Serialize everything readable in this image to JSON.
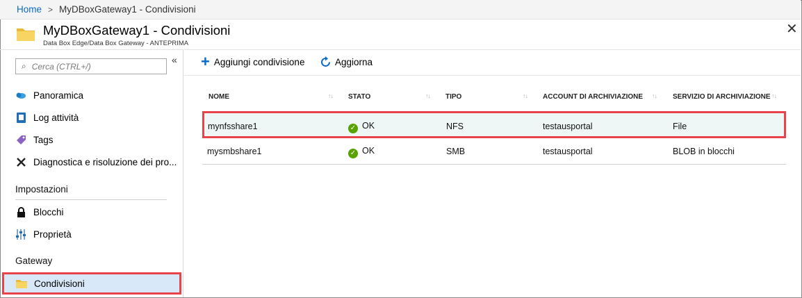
{
  "breadcrumb": {
    "home": "Home",
    "current": "MyDBoxGateway1 - Condivisioni"
  },
  "header": {
    "title": "MyDBoxGateway1 - Condivisioni",
    "subtitle": "Data Box Edge/Data Box Gateway - ANTEPRIMA",
    "close_icon": "close-icon"
  },
  "sidebar": {
    "search_placeholder": "Cerca (CTRL+/)",
    "collapse_glyph": "«",
    "items": [
      {
        "label": "Panoramica",
        "icon": "cloud-overview-icon"
      },
      {
        "label": "Log attività",
        "icon": "activity-log-icon"
      },
      {
        "label": "Tags",
        "icon": "tag-icon"
      },
      {
        "label": "Diagnostica e risoluzione dei pro...",
        "icon": "wrench-icon"
      }
    ],
    "section_impostazioni": "Impostazioni",
    "settings_items": [
      {
        "label": "Blocchi",
        "icon": "lock-icon"
      },
      {
        "label": "Proprietà",
        "icon": "properties-icon"
      }
    ],
    "section_gateway": "Gateway",
    "gateway_items": [
      {
        "label": "Condivisioni",
        "icon": "folder-icon",
        "selected": true
      }
    ]
  },
  "toolbar": {
    "add_label": "Aggiungi condivisione",
    "refresh_label": "Aggiorna"
  },
  "table": {
    "columns": [
      "NOME",
      "STATO",
      "TIPO",
      "ACCOUNT DI ARCHIVIAZIONE",
      "SERVIZIO DI ARCHIVIAZIONE"
    ],
    "rows": [
      {
        "name": "mynfsshare1",
        "status": "OK",
        "type": "NFS",
        "account": "testausportal",
        "service": "File",
        "highlighted": true
      },
      {
        "name": "mysmbshare1",
        "status": "OK",
        "type": "SMB",
        "account": "testausportal",
        "service": "BLOB in blocchi",
        "highlighted": false
      }
    ]
  },
  "colors": {
    "accent": "#0b6ac9",
    "highlight_border": "#e8424b",
    "ok_green": "#57a300",
    "selected_bg": "#d8e8f8"
  }
}
